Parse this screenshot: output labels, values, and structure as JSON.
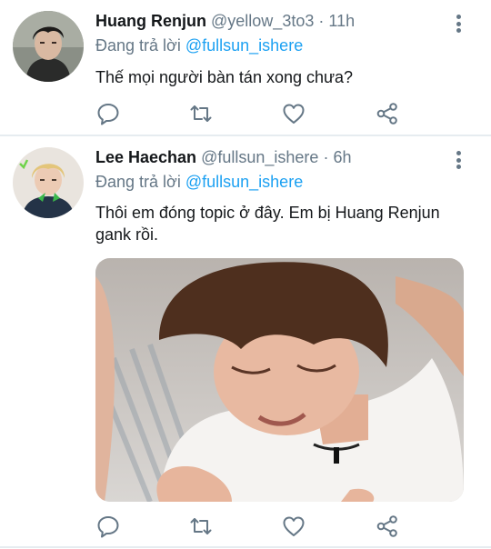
{
  "tweets": [
    {
      "name": "Huang Renjun",
      "handle": "@yellow_3to3",
      "separator": "·",
      "time": "11h",
      "replying_prefix": "Đang trả lời",
      "replying_to": "@fullsun_ishere",
      "text": "Thế mọi người bàn tán xong chưa?",
      "avatar": "avatar-photo"
    },
    {
      "name": "Lee Haechan",
      "handle": "@fullsun_ishere",
      "separator": "·",
      "time": "6h",
      "replying_prefix": "Đang trả lời",
      "replying_to": "@fullsun_ishere",
      "text": "Thôi em đóng topic ở đây. Em bị Huang Renjun gank rồi.",
      "avatar": "avatar-photo",
      "media": "photo-crying-person"
    }
  ],
  "icons": {
    "reply": "reply-icon",
    "retweet": "retweet-icon",
    "like": "like-icon",
    "share": "share-icon",
    "more": "more-options-icon"
  },
  "colors": {
    "text": "#14171a",
    "secondary": "#657786",
    "link": "#1da1f2",
    "divider": "#e6ecf0"
  }
}
